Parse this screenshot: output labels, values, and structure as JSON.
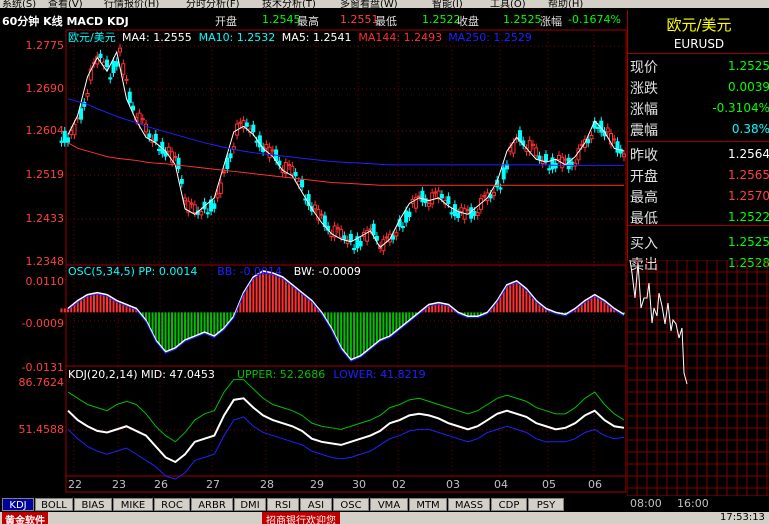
{
  "menu": [
    "系统(S)",
    "查看(V)",
    "行情报价(H)",
    "分时分析(F)",
    "技术分析(T)",
    "多窗看盘(W)",
    "智能(I)",
    "工具(O)",
    "帮助(H)"
  ],
  "titlebar": {
    "period_label": "60分钟 K线 MACD KDJ",
    "open_label": "开盘",
    "open_value": "1.2545",
    "high_label": "最高",
    "high_value": "1.2551",
    "low_label": "最低",
    "low_value": "1.2522",
    "close_label": "收盘",
    "close_value": "1.2525",
    "change_label": "涨幅",
    "change_value": "-0.1674%"
  },
  "price_panel": {
    "title": "欧元/美元",
    "code": "EURUSD",
    "rows": [
      {
        "label": "现价",
        "value": "1.2525",
        "color": "#00ff00"
      },
      {
        "label": "涨跌",
        "value": "0.0039",
        "color": "#00ff00"
      },
      {
        "label": "涨幅",
        "value": "-0.3104%",
        "color": "#00ff00"
      },
      {
        "label": "震幅",
        "value": "0.38%",
        "color": "#00ffff"
      },
      {
        "label": "昨收",
        "value": "1.2564",
        "color": "#ffffff"
      },
      {
        "label": "开盘",
        "value": "1.2565",
        "color": "#ff4040"
      },
      {
        "label": "最高",
        "value": "1.2570",
        "color": "#ff4040"
      },
      {
        "label": "最低",
        "value": "1.2522",
        "color": "#00ff00"
      },
      {
        "label": "买入",
        "value": "1.2525",
        "color": "#00ff00"
      },
      {
        "label": "卖出",
        "value": "1.2528",
        "color": "#00ff00"
      }
    ]
  },
  "main_chart": {
    "symbol": "欧元/美元",
    "ma_legend": [
      {
        "text": "MA4: 1.2555",
        "color": "#ffffff"
      },
      {
        "text": "MA10: 1.2532",
        "color": "#00ffff"
      },
      {
        "text": "MA5: 1.2541",
        "color": "#ffffff"
      },
      {
        "text": "MA144: 1.2493",
        "color": "#ff3030"
      },
      {
        "text": "MA250: 1.2529",
        "color": "#2020ff"
      }
    ],
    "y_ticks": [
      "1.2775",
      "1.2690",
      "1.2604",
      "1.2519",
      "1.2433",
      "1.2348"
    ]
  },
  "osc_chart": {
    "legend": [
      {
        "text": "OSC(5,34,5) PP: 0.0014",
        "color": "#00ffff"
      },
      {
        "text": "BB: -0.0014",
        "color": "#2020ff"
      },
      {
        "text": "BW: -0.0009",
        "color": "#ffffff"
      }
    ],
    "y_ticks": [
      "0.0110",
      "-0.0009",
      "-0.0131"
    ]
  },
  "kdj_chart": {
    "legend": [
      {
        "text": "KDJ(20,2,14) MID: 47.0453",
        "color": "#ffffff"
      },
      {
        "text": "UPPER: 52.2686",
        "color": "#00c000"
      },
      {
        "text": "LOWER: 41.8219",
        "color": "#2020ff"
      }
    ],
    "y_ticks": [
      "86.7624",
      "51.4588"
    ]
  },
  "date_labels": [
    "22",
    "23",
    "26",
    "27",
    "28",
    "29",
    "30",
    "02",
    "03",
    "04",
    "05",
    "06"
  ],
  "time_labels": [
    "08:00",
    "16:00"
  ],
  "tabs": [
    "KDJ",
    "BOLL",
    "BIAS",
    "MIKE",
    "ROC",
    "ARBR",
    "DMI",
    "RSI",
    "ASI",
    "OSC",
    "VMA",
    "MTM",
    "MASS",
    "CDP",
    "PSY"
  ],
  "status": {
    "brand": "黄金软件",
    "message": "招商银行欢迎您",
    "time": "17:53:13"
  },
  "colors": {
    "up": "#ff3030",
    "down": "#00ffff",
    "grid": "#a00000",
    "accent_green": "#00ff00"
  },
  "chart_data": [
    {
      "type": "line",
      "title": "欧元/美元",
      "ylim": [
        1.2348,
        1.2775
      ],
      "x_categories": [
        "22",
        "23",
        "26",
        "27",
        "28",
        "29",
        "30",
        "02",
        "03",
        "04",
        "05",
        "06"
      ],
      "series": [
        {
          "name": "MA4",
          "values": [
            1.2585,
            1.262,
            1.269,
            1.2725,
            1.27,
            1.2735,
            1.265,
            1.261,
            1.258,
            1.257,
            1.2555,
            1.253,
            1.245,
            1.244,
            1.2455,
            1.247,
            1.253,
            1.259,
            1.26,
            1.2585,
            1.256,
            1.2545,
            1.252,
            1.251,
            1.248,
            1.245,
            1.2425,
            1.2405,
            1.2395,
            1.239,
            1.24,
            1.241,
            1.238,
            1.2395,
            1.243,
            1.246,
            1.247,
            1.2465,
            1.247,
            1.2455,
            1.2445,
            1.244,
            1.2455,
            1.247,
            1.25,
            1.2555,
            1.258,
            1.256,
            1.254,
            1.2535,
            1.254,
            1.253,
            1.2545,
            1.257,
            1.261,
            1.259,
            1.256,
            1.2555
          ]
        },
        {
          "name": "MA144",
          "values": [
            1.257,
            1.256,
            1.2555,
            1.255,
            1.2545,
            1.2542,
            1.254,
            1.2538,
            1.2535,
            1.2533,
            1.2532,
            1.253,
            1.2528,
            1.2526,
            1.2524,
            1.2522,
            1.252,
            1.2518,
            1.2516,
            1.2514,
            1.2512,
            1.251,
            1.2508,
            1.2506,
            1.2504,
            1.2502,
            1.25,
            1.2498,
            1.2497,
            1.2496,
            1.2495,
            1.2494,
            1.2493,
            1.2493,
            1.2493,
            1.2493,
            1.2493,
            1.2493,
            1.2493,
            1.2493,
            1.2493,
            1.2493,
            1.2493,
            1.2493,
            1.2493,
            1.2493,
            1.2493,
            1.2493,
            1.2493,
            1.2493,
            1.2493,
            1.2493,
            1.2493,
            1.2493,
            1.2493,
            1.2493,
            1.2493,
            1.2493
          ]
        },
        {
          "name": "MA250",
          "values": [
            1.265,
            1.2645,
            1.264,
            1.2632,
            1.2625,
            1.2618,
            1.2612,
            1.2607,
            1.26,
            1.2595,
            1.259,
            1.2585,
            1.258,
            1.2575,
            1.257,
            1.2566,
            1.2562,
            1.2558,
            1.2555,
            1.2552,
            1.255,
            1.2548,
            1.2546,
            1.2544,
            1.2542,
            1.254,
            1.2538,
            1.2536,
            1.2535,
            1.2534,
            1.2533,
            1.2532,
            1.2531,
            1.253,
            1.253,
            1.253,
            1.253,
            1.253,
            1.253,
            1.253,
            1.253,
            1.253,
            1.253,
            1.253,
            1.253,
            1.253,
            1.253,
            1.253,
            1.253,
            1.253,
            1.2529,
            1.2529,
            1.2529,
            1.2529,
            1.2529,
            1.2529,
            1.2529,
            1.2529
          ]
        }
      ]
    },
    {
      "type": "bar",
      "title": "OSC(5,34,5)",
      "ylim": [
        -0.0131,
        0.011
      ],
      "values": [
        0.001,
        0.003,
        0.0045,
        0.005,
        0.0045,
        0.003,
        0.002,
        0.001,
        -0.002,
        -0.007,
        -0.01,
        -0.009,
        -0.007,
        -0.006,
        -0.005,
        -0.006,
        -0.004,
        -0.001,
        0.005,
        0.009,
        0.0105,
        0.01,
        0.009,
        0.007,
        0.005,
        0.003,
        0.0,
        -0.004,
        -0.009,
        -0.012,
        -0.011,
        -0.009,
        -0.007,
        -0.006,
        -0.004,
        -0.002,
        0.0,
        0.002,
        0.0025,
        0.002,
        0.0,
        -0.001,
        -0.001,
        0.0,
        0.003,
        0.007,
        0.008,
        0.006,
        0.003,
        0.001,
        0.0,
        -0.0005,
        0.001,
        0.003,
        0.0045,
        0.003,
        0.001,
        -0.0005
      ]
    },
    {
      "type": "line",
      "title": "KDJ(20,2,14)",
      "ylim": [
        16.0,
        86.7624
      ],
      "series": [
        {
          "name": "MID",
          "values": [
            58,
            52,
            48,
            45,
            44,
            46,
            48,
            45,
            42,
            35,
            28,
            25,
            30,
            38,
            40,
            42,
            55,
            65,
            66,
            60,
            55,
            52,
            50,
            48,
            45,
            40,
            38,
            37,
            36,
            38,
            40,
            42,
            45,
            50,
            52,
            55,
            56,
            55,
            53,
            50,
            48,
            46,
            48,
            52,
            56,
            58,
            56,
            54,
            50,
            48,
            46,
            47,
            50,
            55,
            58,
            52,
            48,
            47
          ]
        },
        {
          "name": "UPPER",
          "values": [
            70,
            66,
            62,
            60,
            58,
            62,
            64,
            62,
            56,
            48,
            42,
            38,
            44,
            52,
            56,
            58,
            70,
            78,
            78,
            72,
            66,
            62,
            60,
            58,
            55,
            50,
            48,
            47,
            46,
            48,
            50,
            52,
            55,
            60,
            62,
            65,
            66,
            64,
            62,
            60,
            58,
            56,
            58,
            62,
            66,
            68,
            66,
            64,
            60,
            58,
            56,
            56,
            60,
            66,
            70,
            62,
            56,
            52
          ]
        },
        {
          "name": "LOWER",
          "values": [
            46,
            40,
            35,
            32,
            30,
            32,
            34,
            30,
            26,
            22,
            16,
            14,
            18,
            26,
            28,
            30,
            42,
            52,
            54,
            48,
            44,
            42,
            40,
            38,
            36,
            32,
            30,
            28,
            27,
            28,
            30,
            32,
            36,
            40,
            42,
            45,
            46,
            46,
            44,
            42,
            40,
            38,
            40,
            44,
            46,
            48,
            46,
            44,
            40,
            38,
            38,
            38,
            40,
            44,
            46,
            42,
            40,
            41
          ]
        }
      ]
    }
  ]
}
